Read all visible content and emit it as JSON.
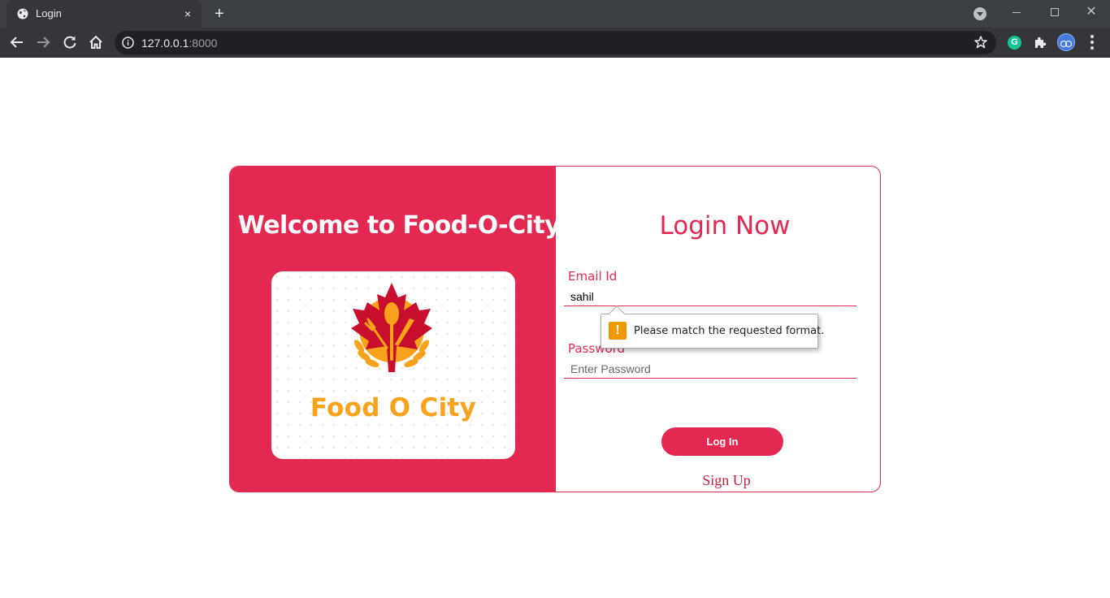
{
  "browser": {
    "tab_title": "Login",
    "tab_close": "×",
    "new_tab": "+",
    "window_close": "✕",
    "url_host": "127.0.0.1",
    "url_port": ":8000",
    "extension_grammarly": "G"
  },
  "brand": {
    "welcome": "Welcome to Food-O-City",
    "logo_text": "Food O City",
    "colors": {
      "primary": "#e32951",
      "logo_orange": "#f9a21b",
      "logo_red": "#c8102e"
    }
  },
  "login": {
    "title": "Login Now",
    "email_label": "Email Id",
    "email_value": "sahil",
    "password_label": "Password",
    "password_placeholder": "Enter Password",
    "submit_label": "Log In",
    "signup_label": "Sign Up"
  },
  "validation": {
    "icon": "!",
    "message": "Please match the requested format."
  }
}
